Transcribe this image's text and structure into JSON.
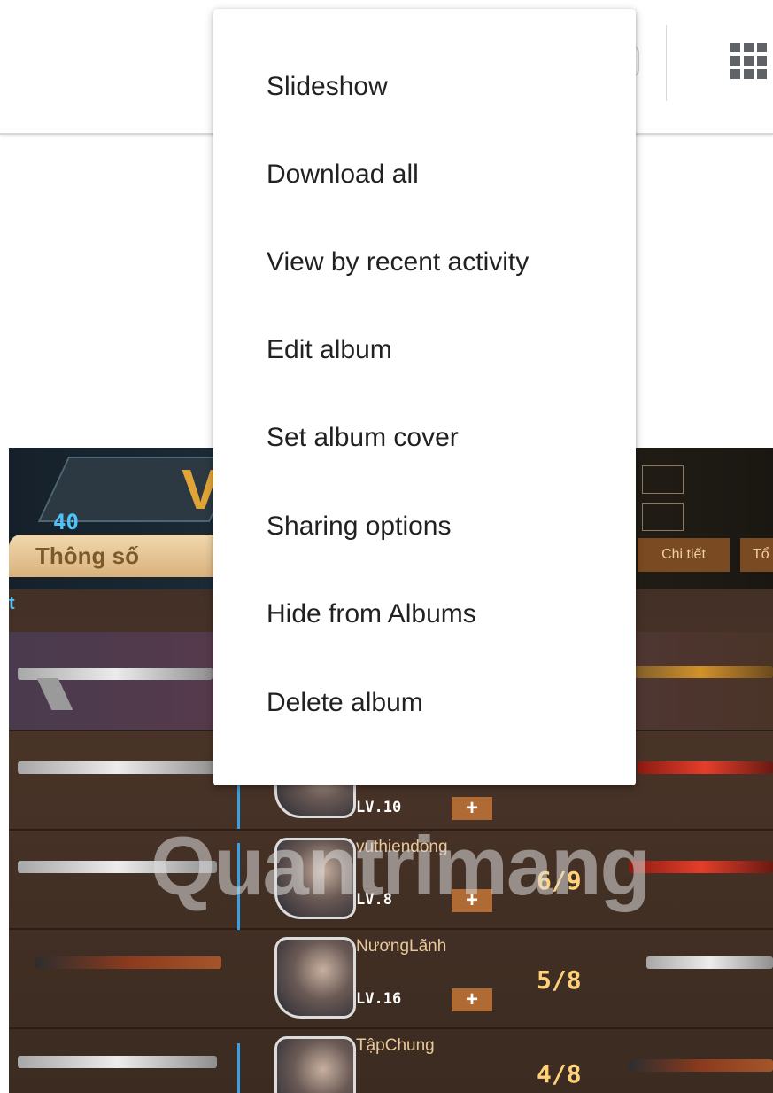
{
  "menu": {
    "items": [
      {
        "label": "Slideshow"
      },
      {
        "label": "Download all"
      },
      {
        "label": "View by recent activity"
      },
      {
        "label": "Edit album"
      },
      {
        "label": "Set album cover"
      },
      {
        "label": "Sharing options"
      },
      {
        "label": "Hide from Albums"
      },
      {
        "label": "Delete album"
      }
    ]
  },
  "header": {
    "apps_icon": "apps-grid-icon"
  },
  "album_image": {
    "level": "40",
    "stats_tab": "Thông số",
    "detail_tab": "Chi tiết",
    "more_tab": "Tổ",
    "watermark": "Quantrimang",
    "players": [
      {
        "name": "",
        "level": "LV.10",
        "score": ""
      },
      {
        "name": "vuthiendong",
        "level": "LV.8",
        "score": "6/9"
      },
      {
        "name": "NươngLãnh",
        "level": "LV.16",
        "score": "5/8"
      },
      {
        "name": "TậpChung",
        "level": "",
        "score": "4/8"
      }
    ]
  },
  "colors": {
    "menu_background": "#ffffff",
    "menu_text": "#212121",
    "divider": "#d7d7d7"
  }
}
